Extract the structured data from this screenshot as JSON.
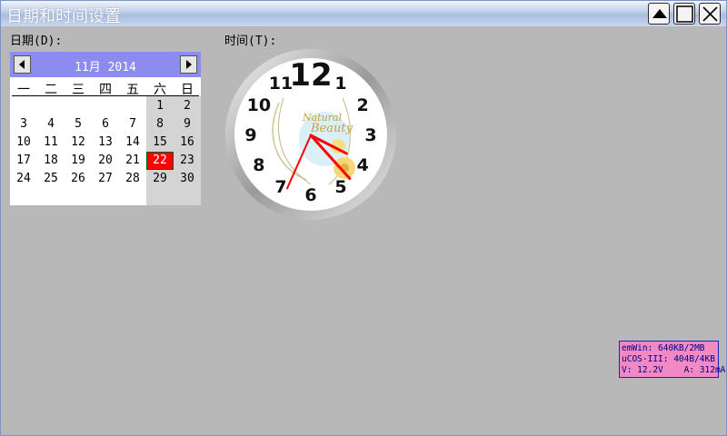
{
  "window": {
    "title": "日期和时间设置"
  },
  "labels": {
    "date": "日期(D):",
    "time": "时间(T):"
  },
  "calendar": {
    "month_year": "11月 2014",
    "weekdays": [
      "一",
      "二",
      "三",
      "四",
      "五",
      "六",
      "日"
    ],
    "weeks": [
      [
        "",
        "",
        "",
        "",
        "",
        "1",
        "2"
      ],
      [
        "3",
        "4",
        "5",
        "6",
        "7",
        "8",
        "9"
      ],
      [
        "10",
        "11",
        "12",
        "13",
        "14",
        "15",
        "16"
      ],
      [
        "17",
        "18",
        "19",
        "20",
        "21",
        "22",
        "23"
      ],
      [
        "24",
        "25",
        "26",
        "27",
        "28",
        "29",
        "30"
      ]
    ],
    "selected_day": "22",
    "selected_color": "#ff0000",
    "header_color": "#8c8cf0"
  },
  "clock": {
    "numerals": [
      "12",
      "1",
      "2",
      "3",
      "4",
      "5",
      "6",
      "7",
      "8",
      "9",
      "10",
      "11"
    ],
    "brand_line1": "Natural",
    "brand_line2": "Beauty",
    "hour": 3.9,
    "minute": 23,
    "second": 34,
    "hand_color": "#ff0000"
  },
  "status": {
    "line1": "emWin: 640KB/2MB",
    "line2": "uCOS-III: 404B/4KB",
    "line3": "V: 12.2V    A: 312mA"
  }
}
